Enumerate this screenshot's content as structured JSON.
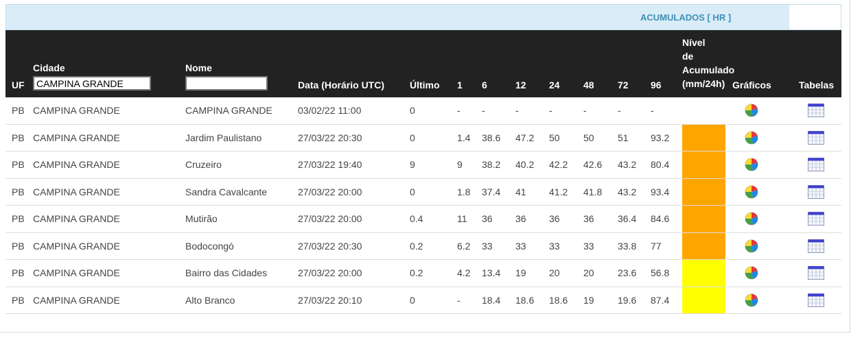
{
  "header": {
    "acumulados_title": "ACUMULADOS [ HR ]"
  },
  "columns": {
    "uf": "UF",
    "cidade": "Cidade",
    "nome": "Nome",
    "data": "Data (Horário UTC)",
    "ultimo": "Último",
    "h1": "1",
    "h6": "6",
    "h12": "12",
    "h24": "24",
    "h48": "48",
    "h72": "72",
    "h96": "96",
    "nivel_lines": [
      "Nível",
      "de",
      "Acumulado",
      "(mm/24h)"
    ],
    "graficos": "Gráficos",
    "tabelas": "Tabelas"
  },
  "filters": {
    "cidade_value": "CAMPINA GRANDE",
    "nome_value": ""
  },
  "colors": {
    "header_bg": "#222222",
    "orange": "#FFA500",
    "yellow": "#FFFF00",
    "accent": "#3F8FB8"
  },
  "icons": {
    "graficos": "pie-chart-icon",
    "tabelas": "calendar-table-icon"
  },
  "rows": [
    {
      "uf": "PB",
      "cidade": "CAMPINA GRANDE",
      "nome": "CAMPINA GRANDE",
      "data": "03/02/22 11:00",
      "ultimo": "0",
      "h1": "-",
      "h6": "-",
      "h12": "-",
      "h24": "-",
      "h48": "-",
      "h72": "-",
      "h96": "-",
      "level": "none"
    },
    {
      "uf": "PB",
      "cidade": "CAMPINA GRANDE",
      "nome": "Jardim Paulistano",
      "data": "27/03/22 20:30",
      "ultimo": "0",
      "h1": "1.4",
      "h6": "38.6",
      "h12": "47.2",
      "h24": "50",
      "h48": "50",
      "h72": "51",
      "h96": "93.2",
      "level": "orange"
    },
    {
      "uf": "PB",
      "cidade": "CAMPINA GRANDE",
      "nome": "Cruzeiro",
      "data": "27/03/22 19:40",
      "ultimo": "9",
      "h1": "9",
      "h6": "38.2",
      "h12": "40.2",
      "h24": "42.2",
      "h48": "42.6",
      "h72": "43.2",
      "h96": "80.4",
      "level": "orange"
    },
    {
      "uf": "PB",
      "cidade": "CAMPINA GRANDE",
      "nome": "Sandra Cavalcante",
      "data": "27/03/22 20:00",
      "ultimo": "0",
      "h1": "1.8",
      "h6": "37.4",
      "h12": "41",
      "h24": "41.2",
      "h48": "41.8",
      "h72": "43.2",
      "h96": "93.4",
      "level": "orange"
    },
    {
      "uf": "PB",
      "cidade": "CAMPINA GRANDE",
      "nome": "Mutirão",
      "data": "27/03/22 20:00",
      "ultimo": "0.4",
      "h1": "11",
      "h6": "36",
      "h12": "36",
      "h24": "36",
      "h48": "36",
      "h72": "36.4",
      "h96": "84.6",
      "level": "orange"
    },
    {
      "uf": "PB",
      "cidade": "CAMPINA GRANDE",
      "nome": "Bodocongó",
      "data": "27/03/22 20:30",
      "ultimo": "0.2",
      "h1": "6.2",
      "h6": "33",
      "h12": "33",
      "h24": "33",
      "h48": "33",
      "h72": "33.8",
      "h96": "77",
      "level": "orange"
    },
    {
      "uf": "PB",
      "cidade": "CAMPINA GRANDE",
      "nome": "Bairro das Cidades",
      "data": "27/03/22 20:00",
      "ultimo": "0.2",
      "h1": "4.2",
      "h6": "13.4",
      "h12": "19",
      "h24": "20",
      "h48": "20",
      "h72": "23.6",
      "h96": "56.8",
      "level": "yellow"
    },
    {
      "uf": "PB",
      "cidade": "CAMPINA GRANDE",
      "nome": "Alto Branco",
      "data": "27/03/22 20:10",
      "ultimo": "0",
      "h1": "-",
      "h6": "18.4",
      "h12": "18.6",
      "h24": "18.6",
      "h48": "19",
      "h72": "19.6",
      "h96": "87.4",
      "level": "yellow"
    }
  ]
}
